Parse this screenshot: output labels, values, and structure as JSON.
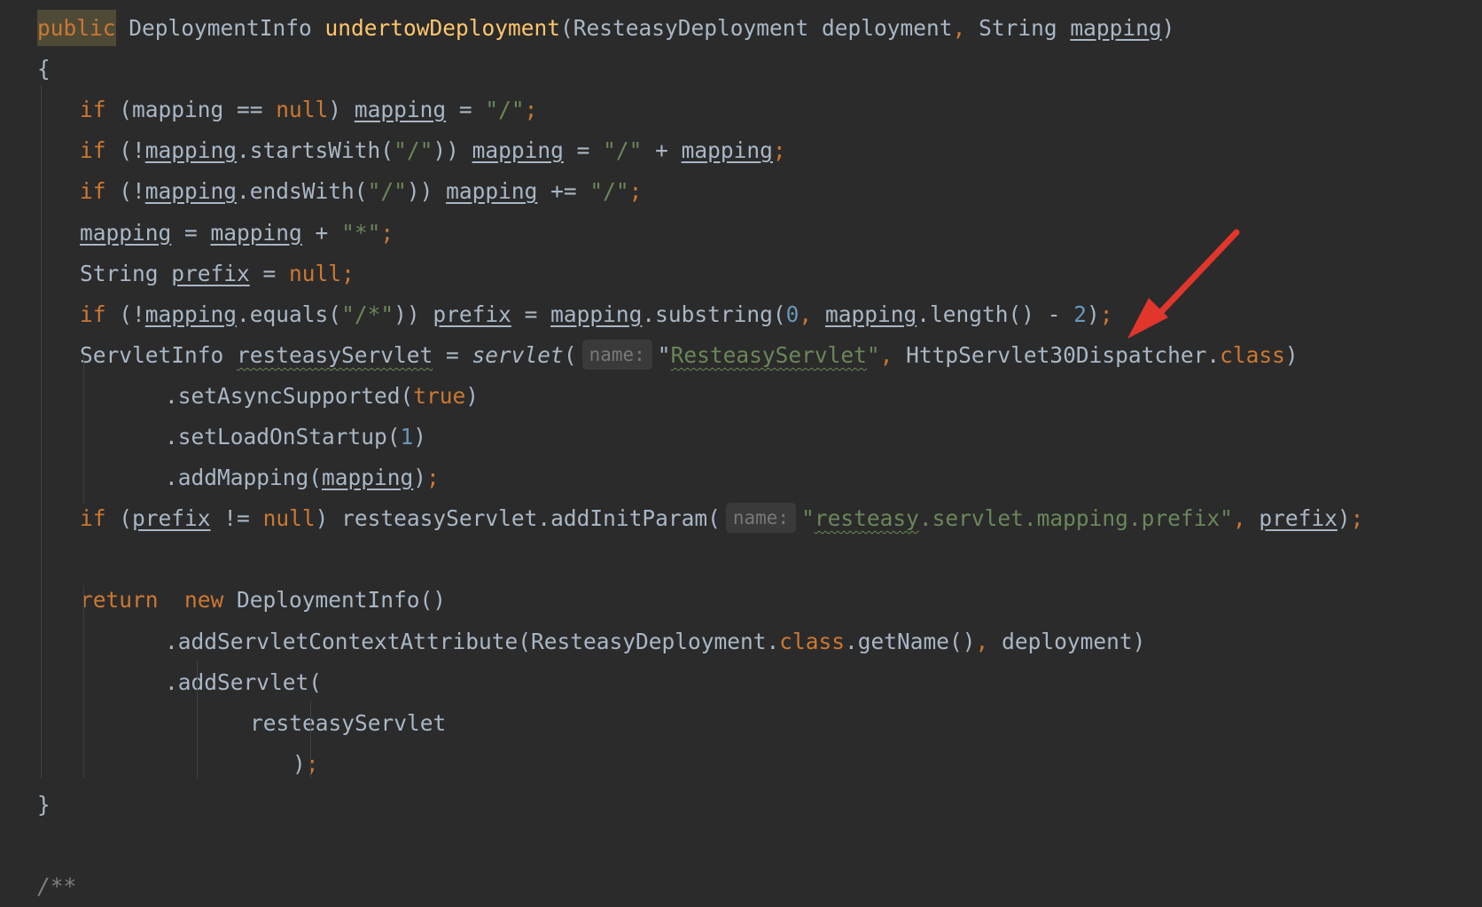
{
  "editor": {
    "lines": [
      {
        "indent": 0,
        "parts": [
          {
            "t": "public",
            "c": "kw pub-hl"
          },
          {
            "t": " DeploymentInfo "
          },
          {
            "t": "undertowDeployment",
            "c": "fn"
          },
          {
            "t": "(ResteasyDeployment deployment"
          },
          {
            "t": ",",
            "c": "kw"
          },
          {
            "t": " String "
          },
          {
            "t": "mapping",
            "c": "ul"
          },
          {
            "t": ")"
          }
        ]
      },
      {
        "indent": 0,
        "parts": [
          {
            "t": "{"
          }
        ]
      },
      {
        "indent": 1,
        "parts": [
          {
            "t": "if",
            "c": "kw"
          },
          {
            "t": " (mapping == "
          },
          {
            "t": "null",
            "c": "kw"
          },
          {
            "t": ") "
          },
          {
            "t": "mapping",
            "c": "ul"
          },
          {
            "t": " = "
          },
          {
            "t": "\"/\"",
            "c": "str"
          },
          {
            "t": ";",
            "c": "kw"
          }
        ]
      },
      {
        "indent": 1,
        "parts": [
          {
            "t": "if",
            "c": "kw"
          },
          {
            "t": " (!"
          },
          {
            "t": "mapping",
            "c": "ul"
          },
          {
            "t": ".startsWith("
          },
          {
            "t": "\"/\"",
            "c": "str"
          },
          {
            "t": ")) "
          },
          {
            "t": "mapping",
            "c": "ul"
          },
          {
            "t": " = "
          },
          {
            "t": "\"/\"",
            "c": "str"
          },
          {
            "t": " + "
          },
          {
            "t": "mapping",
            "c": "ul"
          },
          {
            "t": ";",
            "c": "kw"
          }
        ]
      },
      {
        "indent": 1,
        "parts": [
          {
            "t": "if",
            "c": "kw"
          },
          {
            "t": " (!"
          },
          {
            "t": "mapping",
            "c": "ul"
          },
          {
            "t": ".endsWith("
          },
          {
            "t": "\"/\"",
            "c": "str"
          },
          {
            "t": ")) "
          },
          {
            "t": "mapping",
            "c": "ul"
          },
          {
            "t": " += "
          },
          {
            "t": "\"/\"",
            "c": "str"
          },
          {
            "t": ";",
            "c": "kw"
          }
        ]
      },
      {
        "indent": 1,
        "parts": [
          {
            "t": "mapping",
            "c": "ul"
          },
          {
            "t": " = "
          },
          {
            "t": "mapping",
            "c": "ul"
          },
          {
            "t": " + "
          },
          {
            "t": "\"*\"",
            "c": "str"
          },
          {
            "t": ";",
            "c": "kw"
          }
        ]
      },
      {
        "indent": 1,
        "parts": [
          {
            "t": "String "
          },
          {
            "t": "prefix",
            "c": "ul"
          },
          {
            "t": " = "
          },
          {
            "t": "null",
            "c": "kw"
          },
          {
            "t": ";",
            "c": "kw"
          }
        ]
      },
      {
        "indent": 1,
        "parts": [
          {
            "t": "if",
            "c": "kw"
          },
          {
            "t": " (!"
          },
          {
            "t": "mapping",
            "c": "ul"
          },
          {
            "t": ".equals("
          },
          {
            "t": "\"/*\"",
            "c": "str"
          },
          {
            "t": ")) "
          },
          {
            "t": "prefix",
            "c": "ul"
          },
          {
            "t": " = "
          },
          {
            "t": "mapping",
            "c": "ul"
          },
          {
            "t": ".substring("
          },
          {
            "t": "0",
            "c": "num"
          },
          {
            "t": ", ",
            "c": "kw"
          },
          {
            "t": "mapping",
            "c": "ul"
          },
          {
            "t": ".length() - "
          },
          {
            "t": "2",
            "c": "num"
          },
          {
            "t": ")"
          },
          {
            "t": ";",
            "c": "kw"
          }
        ]
      },
      {
        "indent": 1,
        "parts": [
          {
            "t": "ServletInfo "
          },
          {
            "t": "resteasyServlet",
            "c": "squig"
          },
          {
            "t": " = "
          },
          {
            "t": "servlet",
            "c": "it"
          },
          {
            "t": "("
          },
          {
            "t": "name:",
            "c": "hint"
          },
          {
            "t": "\""
          },
          {
            "t": "ResteasyServlet",
            "c": "str squig"
          },
          {
            "t": "\"",
            "c": "str"
          },
          {
            "t": ", ",
            "c": "kw"
          },
          {
            "t": "HttpServlet30Dispatcher."
          },
          {
            "t": "class",
            "c": "kw"
          },
          {
            "t": ")"
          }
        ]
      },
      {
        "indent": 3,
        "parts": [
          {
            "t": ".setAsyncSupported("
          },
          {
            "t": "true",
            "c": "kw"
          },
          {
            "t": ")"
          }
        ]
      },
      {
        "indent": 3,
        "parts": [
          {
            "t": ".setLoadOnStartup("
          },
          {
            "t": "1",
            "c": "num"
          },
          {
            "t": ")"
          }
        ]
      },
      {
        "indent": 3,
        "parts": [
          {
            "t": ".addMapping("
          },
          {
            "t": "mapping",
            "c": "ul"
          },
          {
            "t": ")"
          },
          {
            "t": ";",
            "c": "kw"
          }
        ]
      },
      {
        "indent": 1,
        "parts": [
          {
            "t": "if",
            "c": "kw"
          },
          {
            "t": " ("
          },
          {
            "t": "prefix",
            "c": "ul"
          },
          {
            "t": " != "
          },
          {
            "t": "null",
            "c": "kw"
          },
          {
            "t": ") resteasyServlet.addInitParam("
          },
          {
            "t": "name:",
            "c": "hint"
          },
          {
            "t": "\"",
            "c": "str"
          },
          {
            "t": "resteasy",
            "c": "str squig"
          },
          {
            "t": ".servlet.mapping.prefix\"",
            "c": "str"
          },
          {
            "t": ", ",
            "c": "kw"
          },
          {
            "t": "prefix",
            "c": "ul"
          },
          {
            "t": ")"
          },
          {
            "t": ";",
            "c": "kw"
          }
        ]
      },
      {
        "indent": 0,
        "parts": []
      },
      {
        "indent": 1,
        "parts": [
          {
            "t": "return",
            "c": "kw"
          },
          {
            "t": "  "
          },
          {
            "t": "new",
            "c": "kw"
          },
          {
            "t": " DeploymentInfo()"
          }
        ]
      },
      {
        "indent": 3,
        "parts": [
          {
            "t": ".addServletContextAttribute(ResteasyDeployment."
          },
          {
            "t": "class",
            "c": "kw"
          },
          {
            "t": ".getName()"
          },
          {
            "t": ", ",
            "c": "kw"
          },
          {
            "t": "deployment)"
          }
        ]
      },
      {
        "indent": 3,
        "parts": [
          {
            "t": ".addServlet("
          }
        ]
      },
      {
        "indent": 5,
        "parts": [
          {
            "t": "resteasyServlet"
          }
        ]
      },
      {
        "indent": 6,
        "parts": [
          {
            "t": ")"
          },
          {
            "t": ";",
            "c": "kw"
          }
        ]
      },
      {
        "indent": 0,
        "parts": [
          {
            "t": "}"
          }
        ]
      },
      {
        "indent": 0,
        "parts": []
      },
      {
        "indent": 0,
        "parts": [
          {
            "t": "/**",
            "c": "comment"
          }
        ]
      }
    ]
  },
  "annotation": {
    "color": "#e0362c",
    "type": "arrow"
  }
}
